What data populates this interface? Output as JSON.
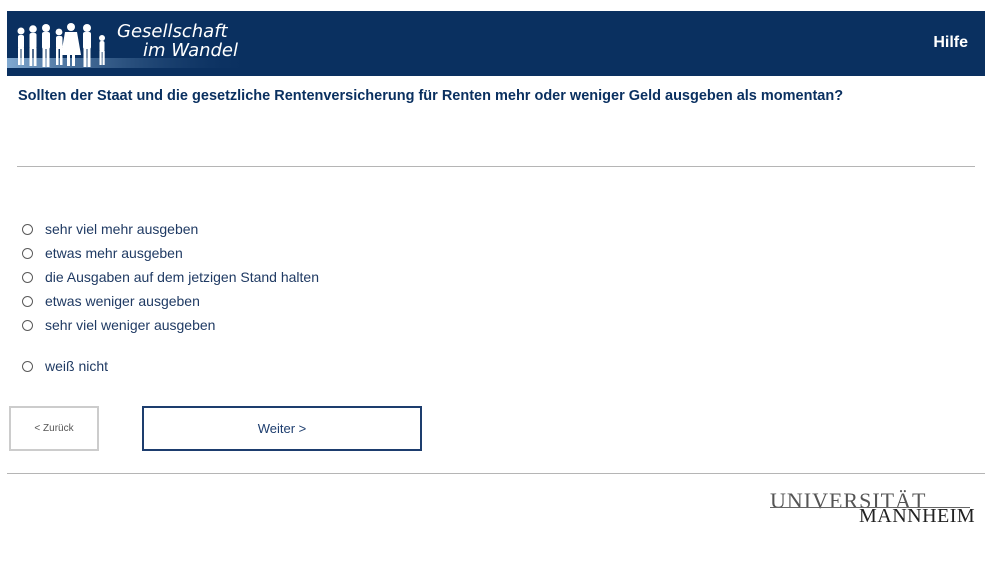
{
  "header": {
    "logo_line1": "Gesellschaft",
    "logo_line2": "im Wandel",
    "help_label": "Hilfe"
  },
  "question": {
    "text": "Sollten der Staat und die gesetzliche Rentenversicherung für Renten mehr oder weniger Geld ausgeben als momentan?"
  },
  "options": [
    {
      "label": "sehr viel mehr ausgeben",
      "selected": false
    },
    {
      "label": "etwas mehr ausgeben",
      "selected": false
    },
    {
      "label": "die Ausgaben auf dem jetzigen Stand halten",
      "selected": false
    },
    {
      "label": "etwas weniger ausgeben",
      "selected": false
    },
    {
      "label": "sehr viel weniger ausgeben",
      "selected": false
    },
    {
      "label": "weiß nicht",
      "selected": false
    }
  ],
  "nav": {
    "back_label": "< Zurück",
    "next_label": "Weiter >"
  },
  "footer": {
    "uni_line1": "UNIVERSITÄT",
    "uni_line2": "MANNHEIM"
  },
  "colors": {
    "brand": "#0a3060",
    "text": "#1f3a63",
    "divider": "#b5b5b5"
  }
}
